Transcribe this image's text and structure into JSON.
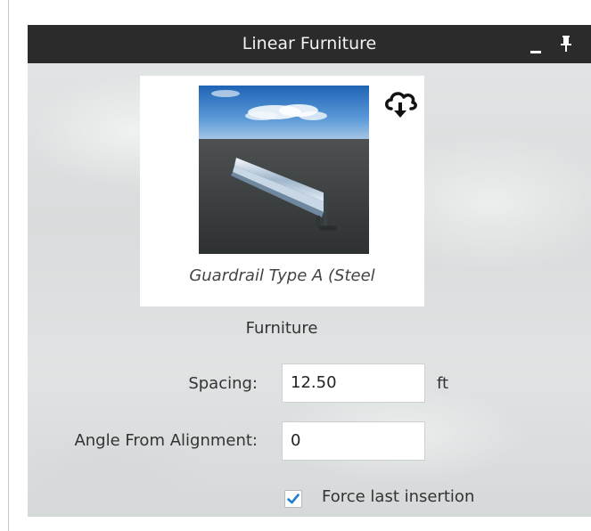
{
  "window": {
    "title": "Linear Furniture",
    "minimize_icon": "minimize-icon",
    "pin_icon": "pin-icon"
  },
  "thumbnail": {
    "caption": "Guardrail Type A (Steel",
    "cloud_icon": "cloud-download-icon"
  },
  "category": "Furniture",
  "fields": {
    "spacing": {
      "label": "Spacing:",
      "value": "12.50",
      "unit": "ft"
    },
    "angle": {
      "label": "Angle From Alignment:",
      "value": "0"
    }
  },
  "force_last_insertion": {
    "label": "Force last insertion",
    "checked": true
  },
  "colors": {
    "titlebar": "#2b2b2b",
    "check": "#1f7fd0",
    "panel_bg": "#dfe2e2"
  }
}
